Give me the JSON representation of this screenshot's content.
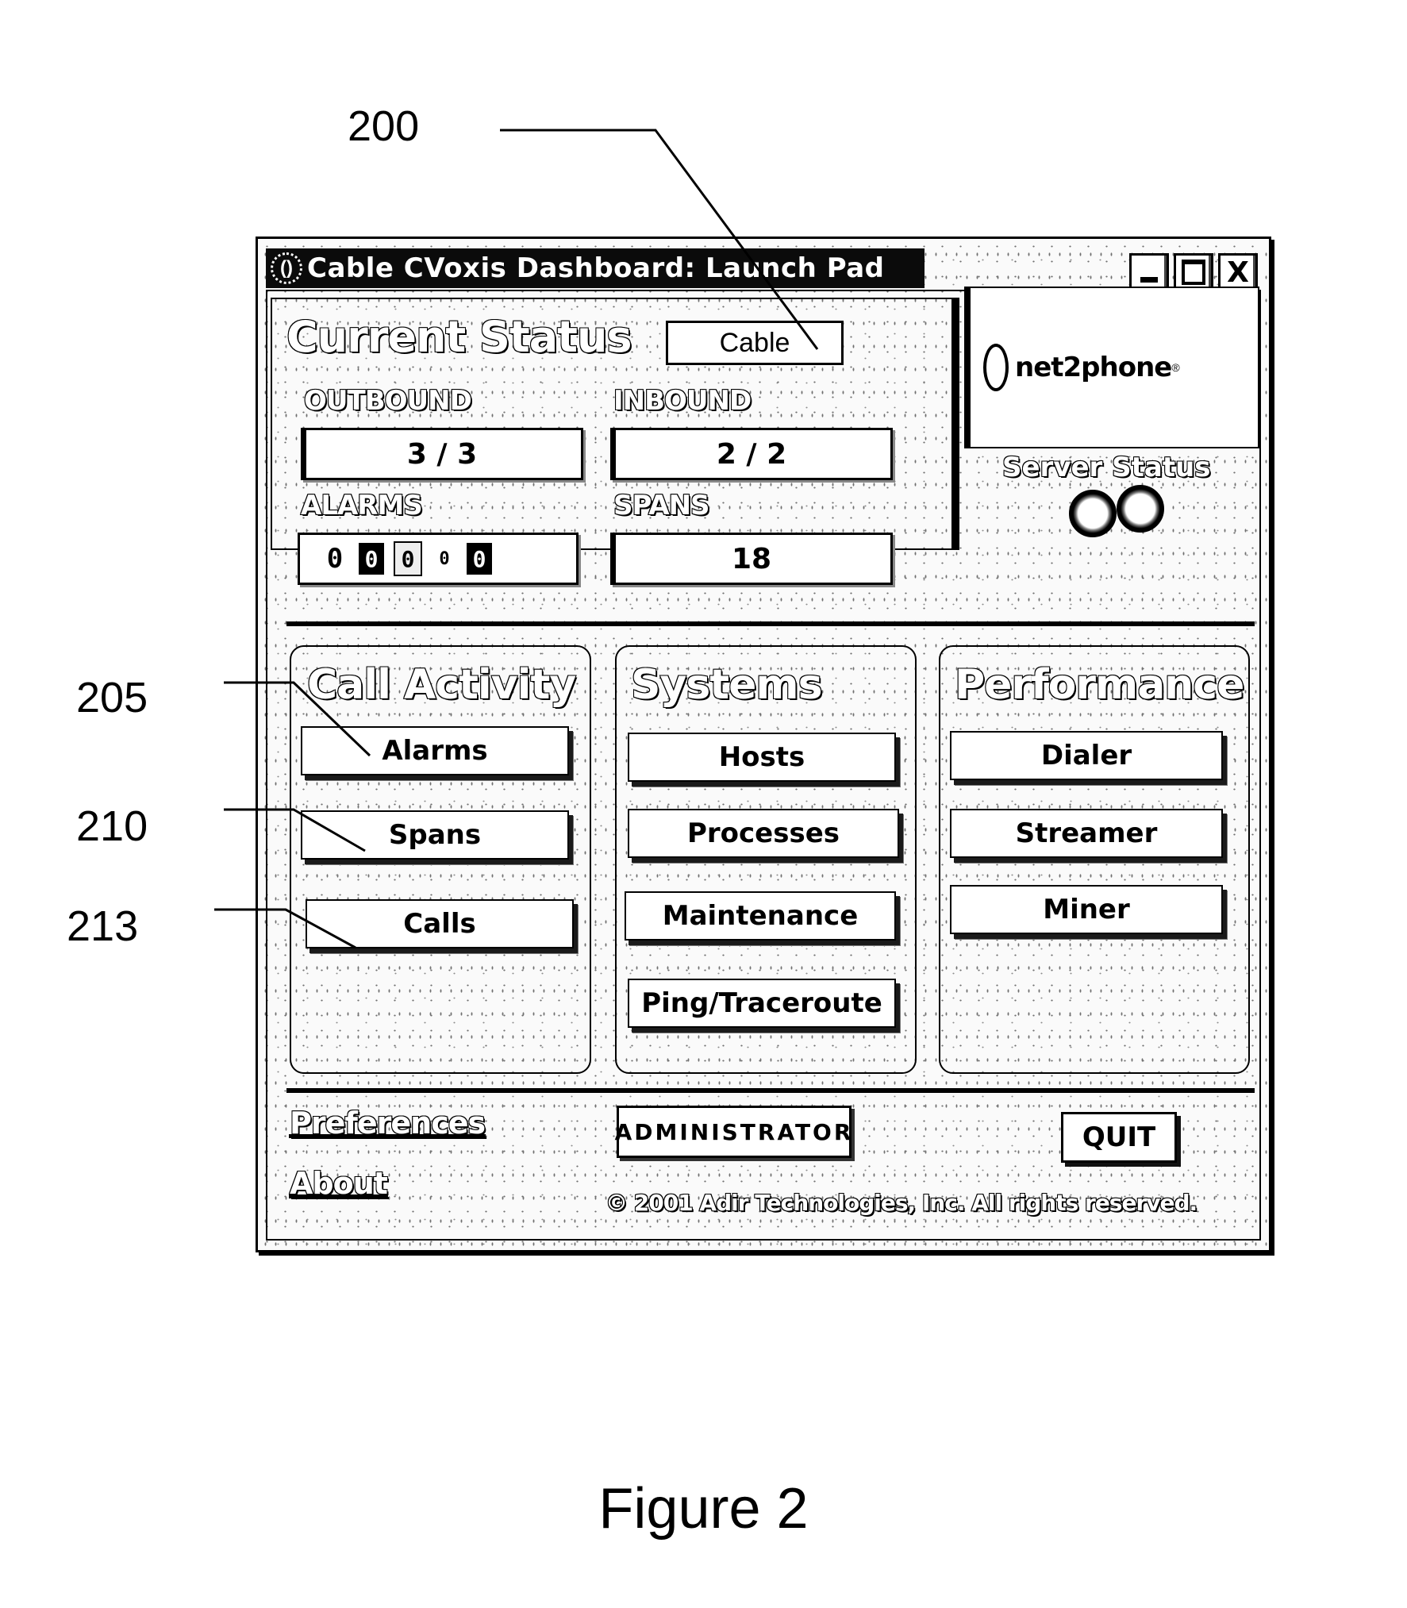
{
  "figure": {
    "caption": "Figure 2",
    "reference_labels": {
      "window": "200",
      "alarms_button": "205",
      "spans_button": "210",
      "calls_button": "213"
    }
  },
  "window": {
    "title": "Cable CVoxis Dashboard: Launch Pad",
    "app_icon": "cvoxis-logo-icon",
    "controls": {
      "minimize": "minimize-icon",
      "maximize": "maximize-icon",
      "close": "close-icon",
      "close_glyph": "X"
    }
  },
  "current_status": {
    "heading": "Current Status",
    "mode": "Cable",
    "outbound": {
      "label": "OUTBOUND",
      "value": "3 / 3"
    },
    "inbound": {
      "label": "INBOUND",
      "value": "2 / 2"
    },
    "alarms": {
      "label": "ALARMS",
      "counters": [
        "0",
        "0",
        "0",
        "0",
        "0"
      ]
    },
    "spans": {
      "label": "SPANS",
      "value": "18"
    }
  },
  "brand": {
    "logo_text": "net2phone",
    "trademark": "®"
  },
  "server_status": {
    "label": "Server Status",
    "indicators": [
      "server-1",
      "server-2"
    ]
  },
  "groups": {
    "call_activity": {
      "title": "Call Activity",
      "buttons": [
        "Alarms",
        "Spans",
        "Calls"
      ]
    },
    "systems": {
      "title": "Systems",
      "buttons": [
        "Hosts",
        "Processes",
        "Maintenance",
        "Ping/Traceroute"
      ]
    },
    "performance": {
      "title": "Performance",
      "buttons": [
        "Dialer",
        "Streamer",
        "Miner"
      ]
    }
  },
  "footer": {
    "preferences": "Preferences",
    "about": "About",
    "administrator": "ADMINISTRATOR",
    "quit": "QUIT",
    "copyright": "© 2001 Adir Technologies, Inc. All rights reserved."
  }
}
